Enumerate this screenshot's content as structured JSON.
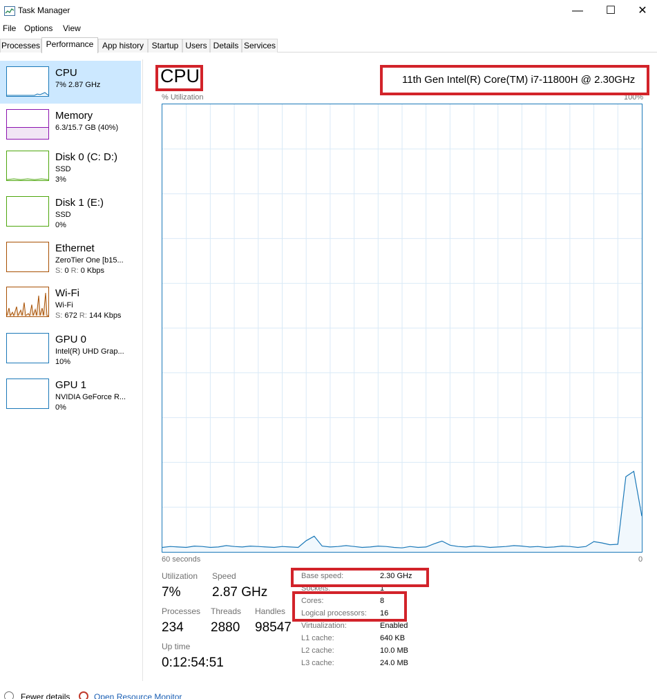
{
  "window": {
    "title": "Task Manager",
    "minimize": "—",
    "maximize": "☐",
    "close": "✕"
  },
  "menu": [
    "File",
    "Options",
    "View"
  ],
  "tabs": [
    "Processes",
    "Performance",
    "App history",
    "Startup",
    "Users",
    "Details",
    "Services"
  ],
  "active_tab": "Performance",
  "sidebar": {
    "items": [
      {
        "title": "CPU",
        "line1": "7%  2.87 GHz",
        "line2": "",
        "color": "#1a78b8",
        "selected": true
      },
      {
        "title": "Memory",
        "line1": "6.3/15.7 GB (40%)",
        "line2": "",
        "color": "#8b12ae"
      },
      {
        "title": "Disk 0 (C: D:)",
        "line1": "SSD",
        "line2": "3%",
        "color": "#4da60c"
      },
      {
        "title": "Disk 1 (E:)",
        "line1": "SSD",
        "line2": "0%",
        "color": "#4da60c"
      },
      {
        "title": "Ethernet",
        "line1": "ZeroTier One [b15...",
        "line2_s_label": "S:",
        "line2_s": "0",
        "line2_r_label": "R:",
        "line2_r": "0 Kbps",
        "color": "#a74f01"
      },
      {
        "title": "Wi-Fi",
        "line1": "Wi-Fi",
        "line2_s_label": "S:",
        "line2_s": "672",
        "line2_r_label": "R:",
        "line2_r": "144 Kbps",
        "color": "#a74f01"
      },
      {
        "title": "GPU 0",
        "line1": "Intel(R) UHD Grap...",
        "line2": "10%",
        "color": "#1a78b8"
      },
      {
        "title": "GPU 1",
        "line1": "NVIDIA GeForce R...",
        "line2": "0%",
        "color": "#1a78b8"
      }
    ]
  },
  "main": {
    "title": "CPU",
    "cpu_name": "11th Gen Intel(R) Core(TM) i7-11800H @ 2.30GHz",
    "util_label": "% Utilization",
    "util_max": "100%",
    "time_left": "60 seconds",
    "time_right": "0",
    "stats": {
      "utilization_label": "Utilization",
      "utilization": "7%",
      "speed_label": "Speed",
      "speed": "2.87 GHz",
      "processes_label": "Processes",
      "processes": "234",
      "threads_label": "Threads",
      "threads": "2880",
      "handles_label": "Handles",
      "handles": "98547",
      "uptime_label": "Up time",
      "uptime": "0:12:54:51"
    },
    "specs": [
      {
        "label": "Base speed:",
        "value": "2.30 GHz"
      },
      {
        "label": "Sockets:",
        "value": "1"
      },
      {
        "label": "Cores:",
        "value": "8"
      },
      {
        "label": "Logical processors:",
        "value": "16"
      },
      {
        "label": "Virtualization:",
        "value": "Enabled"
      },
      {
        "label": "L1 cache:",
        "value": "640 KB"
      },
      {
        "label": "L2 cache:",
        "value": "10.0 MB"
      },
      {
        "label": "L3 cache:",
        "value": "24.0 MB"
      }
    ]
  },
  "footer": {
    "fewer_details": "Fewer details",
    "resource_monitor": "Open Resource Monitor"
  },
  "chart_data": {
    "type": "area",
    "title": "% Utilization",
    "xlabel": "60 seconds",
    "ylim": [
      0,
      100
    ],
    "x": [
      60,
      59,
      58,
      57,
      56,
      55,
      54,
      53,
      52,
      51,
      50,
      49,
      48,
      47,
      46,
      45,
      44,
      43,
      42,
      41,
      40,
      39,
      38,
      37,
      36,
      35,
      34,
      33,
      32,
      31,
      30,
      29,
      28,
      27,
      26,
      25,
      24,
      23,
      22,
      21,
      20,
      19,
      18,
      17,
      16,
      15,
      14,
      13,
      12,
      11,
      10,
      9,
      8,
      7,
      6,
      5,
      4,
      3,
      2,
      1,
      0
    ],
    "values": [
      1.0,
      1.2,
      1.1,
      1.0,
      1.3,
      1.2,
      1.0,
      1.1,
      1.4,
      1.2,
      1.1,
      1.3,
      1.2,
      1.1,
      1.0,
      1.2,
      1.1,
      1.0,
      2.5,
      3.5,
      1.3,
      1.1,
      1.2,
      1.4,
      1.2,
      1.0,
      1.1,
      1.3,
      1.2,
      1.0,
      0.9,
      1.2,
      1.0,
      1.1,
      1.8,
      2.4,
      1.5,
      1.2,
      1.1,
      1.3,
      1.2,
      1.0,
      1.1,
      1.2,
      1.4,
      1.3,
      1.1,
      1.2,
      1.0,
      1.1,
      1.3,
      1.2,
      1.0,
      1.2,
      2.3,
      2.0,
      1.6,
      1.7,
      16.8,
      18.0,
      8.0
    ],
    "grid": true
  }
}
